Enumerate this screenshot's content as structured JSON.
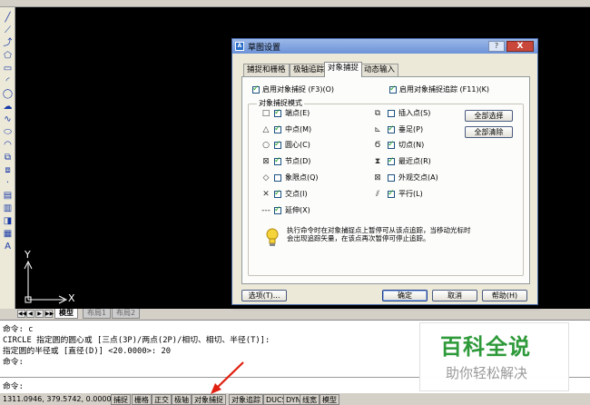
{
  "toolbar": {
    "icons": [
      "line-icon",
      "construction-line-icon",
      "polyline-icon",
      "polygon-icon",
      "rectangle-icon",
      "arc-icon",
      "circle-icon",
      "revision-cloud-icon",
      "spline-icon",
      "ellipse-icon",
      "ellipse-arc-icon",
      "insert-block-icon",
      "make-block-icon",
      "point-icon",
      "hatch-icon",
      "gradient-icon",
      "region-icon",
      "table-icon",
      "mtext-icon"
    ],
    "glyphs": [
      "╱",
      "⟋",
      "⤴",
      "⬠",
      "▭",
      "◜",
      "◯",
      "☁",
      "∿",
      "⬭",
      "◠",
      "⧉",
      "⧈",
      "·",
      "▤",
      "▥",
      "◨",
      "▦",
      "A"
    ]
  },
  "ucs": {
    "x_label": "X",
    "y_label": "Y"
  },
  "layout_tabs": {
    "nav": [
      "◀◀",
      "◀",
      "▶",
      "▶▶"
    ],
    "tabs": [
      {
        "label": "模型",
        "active": true
      },
      {
        "label": "布局1",
        "active": false
      },
      {
        "label": "布局2",
        "active": false
      }
    ]
  },
  "command": {
    "history": [
      "命令: c",
      "CIRCLE 指定圆的圆心或 [三点(3P)/两点(2P)/相切、相切、半径(T)]:",
      "指定圆的半径或 [直径(D)] <20.0000>: 20",
      "命令:"
    ],
    "prompt": "命令:"
  },
  "watermark": {
    "title": "百科全说",
    "subtitle": "助你轻松解决"
  },
  "status_bar": {
    "coordinates": "1311.0946, 379.5742, 0.0000",
    "toggles": [
      "捕捉",
      "栅格",
      "正交",
      "极轴",
      "对象捕捉",
      "对象追踪",
      "DUCS",
      "DYN",
      "线宽",
      "模型"
    ]
  },
  "dialog": {
    "title": "草图设置",
    "help_button": "?",
    "close_button": "X",
    "tabs": [
      {
        "label": "捕捉和栅格",
        "active": false
      },
      {
        "label": "极轴追踪",
        "active": false
      },
      {
        "label": "对象捕捉",
        "active": true
      },
      {
        "label": "动态输入",
        "active": false
      }
    ],
    "enable_osnap": {
      "label": "启用对象捕捉 (F3)(O)",
      "checked": true
    },
    "enable_tracking": {
      "label": "启用对象捕捉追踪 (F11)(K)",
      "checked": true
    },
    "group_title": "对象捕捉模式",
    "modes_left": [
      {
        "symbol": "□",
        "icon": "endpoint-icon",
        "label": "端点(E)",
        "checked": true
      },
      {
        "symbol": "△",
        "icon": "midpoint-icon",
        "label": "中点(M)",
        "checked": true
      },
      {
        "symbol": "○",
        "icon": "center-icon",
        "label": "圆心(C)",
        "checked": true
      },
      {
        "symbol": "⊠",
        "icon": "node-icon",
        "label": "节点(D)",
        "checked": true
      },
      {
        "symbol": "◇",
        "icon": "quadrant-icon",
        "label": "象限点(Q)",
        "checked": false
      },
      {
        "symbol": "✕",
        "icon": "intersection-icon",
        "label": "交点(I)",
        "checked": true
      },
      {
        "symbol": "---",
        "icon": "extension-icon",
        "label": "延伸(X)",
        "checked": true
      }
    ],
    "modes_right": [
      {
        "symbol": "⧉",
        "icon": "insertion-icon",
        "label": "插入点(S)",
        "checked": false
      },
      {
        "symbol": "⊾",
        "icon": "perpendicular-icon",
        "label": "垂足(P)",
        "checked": true
      },
      {
        "symbol": "Ϭ",
        "icon": "tangent-icon",
        "label": "切点(N)",
        "checked": true
      },
      {
        "symbol": "⧗",
        "icon": "nearest-icon",
        "label": "最近点(R)",
        "checked": true
      },
      {
        "symbol": "⊠",
        "icon": "apparent-intersection-icon",
        "label": "外观交点(A)",
        "checked": false
      },
      {
        "symbol": "⫽",
        "icon": "parallel-icon",
        "label": "平行(L)",
        "checked": true
      }
    ],
    "select_all": "全部选择",
    "clear_all": "全部清除",
    "tip_lines": [
      "执行命令时在对象捕捉点上暂停可从该点追踪，当移动光标时",
      "会出现追踪矢量，在该点再次暂停可停止追踪。"
    ],
    "options_button": "选项(T)...",
    "ok_button": "确定",
    "cancel_button": "取消",
    "help_footer_button": "帮助(H)"
  }
}
